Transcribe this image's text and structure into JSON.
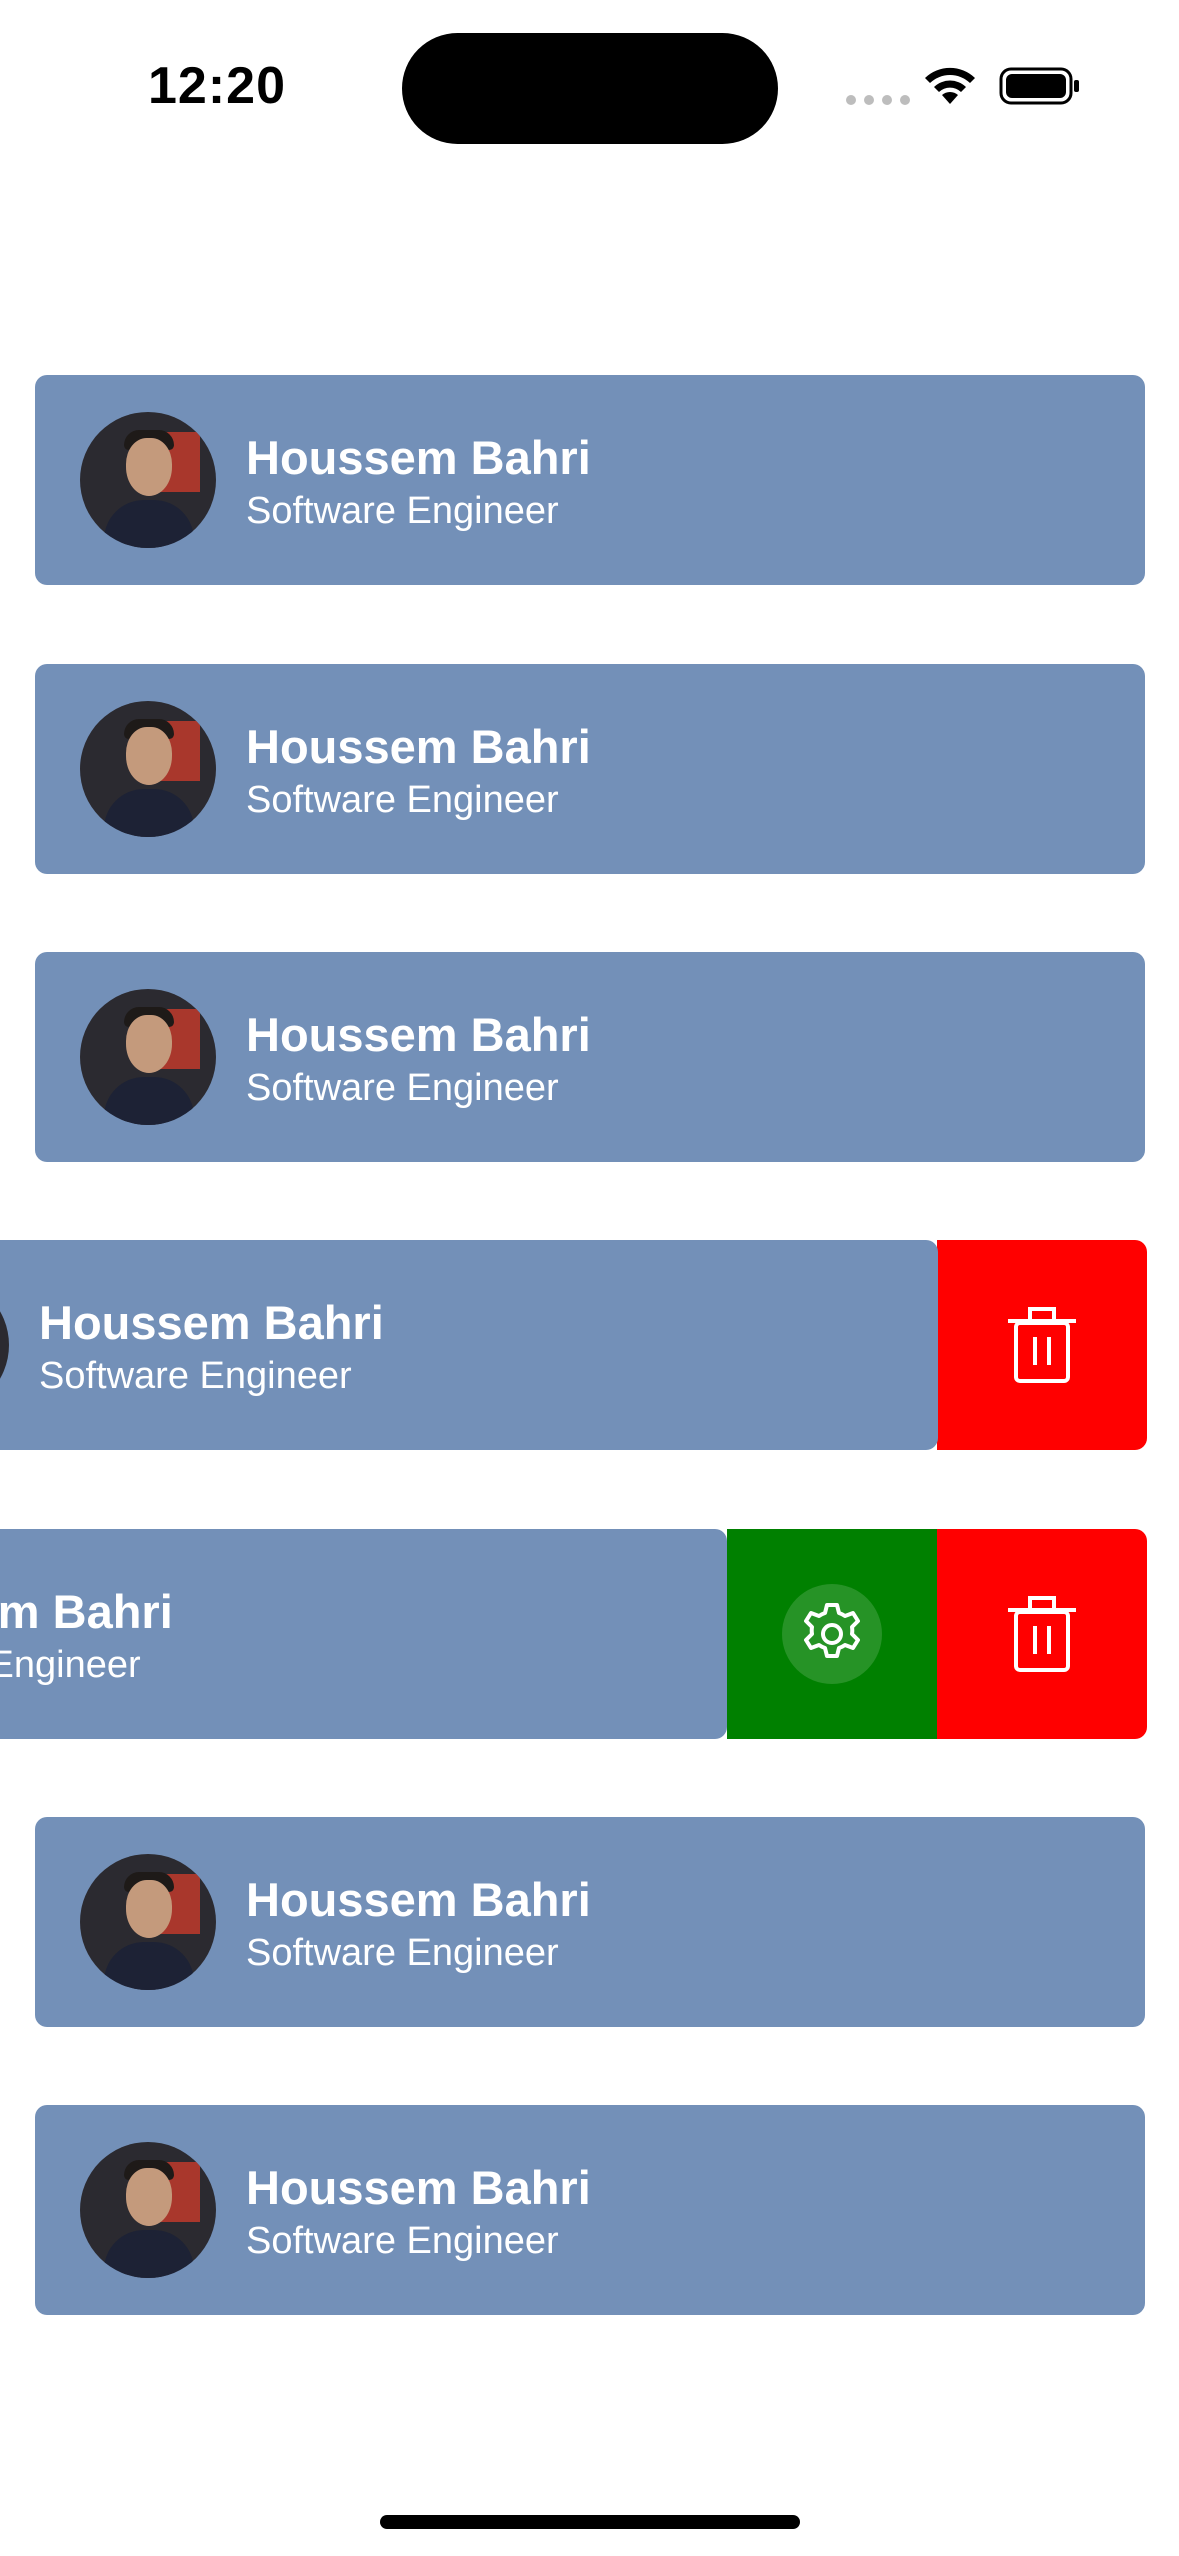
{
  "status_bar": {
    "time": "12:20"
  },
  "contacts": [
    {
      "name": "Houssem Bahri",
      "title": "Software Engineer"
    },
    {
      "name": "Houssem Bahri",
      "title": "Software Engineer"
    },
    {
      "name": "Houssem Bahri",
      "title": "Software Engineer"
    },
    {
      "name": "Houssem Bahri",
      "title": "Software Engineer"
    },
    {
      "name": "Houssem Bahri",
      "title": "Software Engineer"
    },
    {
      "name": "Houssem Bahri",
      "title": "Software Engineer"
    },
    {
      "name": "Houssem Bahri",
      "title": "Software Engineer"
    }
  ],
  "actions": {
    "delete_icon": "trash-icon",
    "settings_icon": "gear-icon",
    "delete_color": "#ff0000",
    "settings_color": "#008000"
  },
  "colors": {
    "card": "#7390b8",
    "text": "#ffffff"
  }
}
